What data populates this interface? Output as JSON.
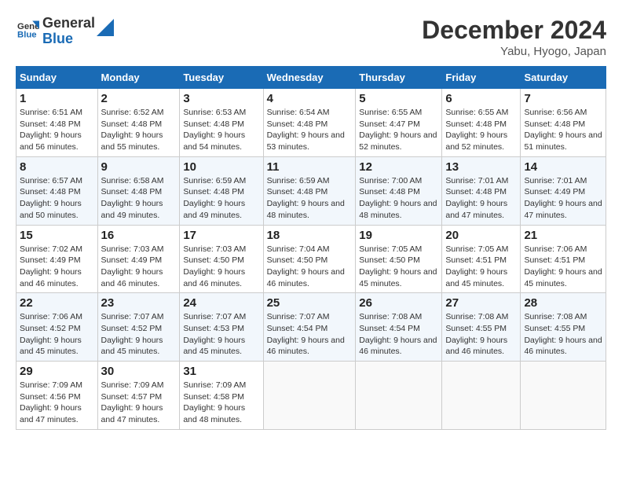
{
  "header": {
    "logo_line1": "General",
    "logo_line2": "Blue",
    "month": "December 2024",
    "location": "Yabu, Hyogo, Japan"
  },
  "weekdays": [
    "Sunday",
    "Monday",
    "Tuesday",
    "Wednesday",
    "Thursday",
    "Friday",
    "Saturday"
  ],
  "weeks": [
    [
      {
        "day": "1",
        "sunrise": "Sunrise: 6:51 AM",
        "sunset": "Sunset: 4:48 PM",
        "daylight": "Daylight: 9 hours and 56 minutes."
      },
      {
        "day": "2",
        "sunrise": "Sunrise: 6:52 AM",
        "sunset": "Sunset: 4:48 PM",
        "daylight": "Daylight: 9 hours and 55 minutes."
      },
      {
        "day": "3",
        "sunrise": "Sunrise: 6:53 AM",
        "sunset": "Sunset: 4:48 PM",
        "daylight": "Daylight: 9 hours and 54 minutes."
      },
      {
        "day": "4",
        "sunrise": "Sunrise: 6:54 AM",
        "sunset": "Sunset: 4:48 PM",
        "daylight": "Daylight: 9 hours and 53 minutes."
      },
      {
        "day": "5",
        "sunrise": "Sunrise: 6:55 AM",
        "sunset": "Sunset: 4:47 PM",
        "daylight": "Daylight: 9 hours and 52 minutes."
      },
      {
        "day": "6",
        "sunrise": "Sunrise: 6:55 AM",
        "sunset": "Sunset: 4:48 PM",
        "daylight": "Daylight: 9 hours and 52 minutes."
      },
      {
        "day": "7",
        "sunrise": "Sunrise: 6:56 AM",
        "sunset": "Sunset: 4:48 PM",
        "daylight": "Daylight: 9 hours and 51 minutes."
      }
    ],
    [
      {
        "day": "8",
        "sunrise": "Sunrise: 6:57 AM",
        "sunset": "Sunset: 4:48 PM",
        "daylight": "Daylight: 9 hours and 50 minutes."
      },
      {
        "day": "9",
        "sunrise": "Sunrise: 6:58 AM",
        "sunset": "Sunset: 4:48 PM",
        "daylight": "Daylight: 9 hours and 49 minutes."
      },
      {
        "day": "10",
        "sunrise": "Sunrise: 6:59 AM",
        "sunset": "Sunset: 4:48 PM",
        "daylight": "Daylight: 9 hours and 49 minutes."
      },
      {
        "day": "11",
        "sunrise": "Sunrise: 6:59 AM",
        "sunset": "Sunset: 4:48 PM",
        "daylight": "Daylight: 9 hours and 48 minutes."
      },
      {
        "day": "12",
        "sunrise": "Sunrise: 7:00 AM",
        "sunset": "Sunset: 4:48 PM",
        "daylight": "Daylight: 9 hours and 48 minutes."
      },
      {
        "day": "13",
        "sunrise": "Sunrise: 7:01 AM",
        "sunset": "Sunset: 4:48 PM",
        "daylight": "Daylight: 9 hours and 47 minutes."
      },
      {
        "day": "14",
        "sunrise": "Sunrise: 7:01 AM",
        "sunset": "Sunset: 4:49 PM",
        "daylight": "Daylight: 9 hours and 47 minutes."
      }
    ],
    [
      {
        "day": "15",
        "sunrise": "Sunrise: 7:02 AM",
        "sunset": "Sunset: 4:49 PM",
        "daylight": "Daylight: 9 hours and 46 minutes."
      },
      {
        "day": "16",
        "sunrise": "Sunrise: 7:03 AM",
        "sunset": "Sunset: 4:49 PM",
        "daylight": "Daylight: 9 hours and 46 minutes."
      },
      {
        "day": "17",
        "sunrise": "Sunrise: 7:03 AM",
        "sunset": "Sunset: 4:50 PM",
        "daylight": "Daylight: 9 hours and 46 minutes."
      },
      {
        "day": "18",
        "sunrise": "Sunrise: 7:04 AM",
        "sunset": "Sunset: 4:50 PM",
        "daylight": "Daylight: 9 hours and 46 minutes."
      },
      {
        "day": "19",
        "sunrise": "Sunrise: 7:05 AM",
        "sunset": "Sunset: 4:50 PM",
        "daylight": "Daylight: 9 hours and 45 minutes."
      },
      {
        "day": "20",
        "sunrise": "Sunrise: 7:05 AM",
        "sunset": "Sunset: 4:51 PM",
        "daylight": "Daylight: 9 hours and 45 minutes."
      },
      {
        "day": "21",
        "sunrise": "Sunrise: 7:06 AM",
        "sunset": "Sunset: 4:51 PM",
        "daylight": "Daylight: 9 hours and 45 minutes."
      }
    ],
    [
      {
        "day": "22",
        "sunrise": "Sunrise: 7:06 AM",
        "sunset": "Sunset: 4:52 PM",
        "daylight": "Daylight: 9 hours and 45 minutes."
      },
      {
        "day": "23",
        "sunrise": "Sunrise: 7:07 AM",
        "sunset": "Sunset: 4:52 PM",
        "daylight": "Daylight: 9 hours and 45 minutes."
      },
      {
        "day": "24",
        "sunrise": "Sunrise: 7:07 AM",
        "sunset": "Sunset: 4:53 PM",
        "daylight": "Daylight: 9 hours and 45 minutes."
      },
      {
        "day": "25",
        "sunrise": "Sunrise: 7:07 AM",
        "sunset": "Sunset: 4:54 PM",
        "daylight": "Daylight: 9 hours and 46 minutes."
      },
      {
        "day": "26",
        "sunrise": "Sunrise: 7:08 AM",
        "sunset": "Sunset: 4:54 PM",
        "daylight": "Daylight: 9 hours and 46 minutes."
      },
      {
        "day": "27",
        "sunrise": "Sunrise: 7:08 AM",
        "sunset": "Sunset: 4:55 PM",
        "daylight": "Daylight: 9 hours and 46 minutes."
      },
      {
        "day": "28",
        "sunrise": "Sunrise: 7:08 AM",
        "sunset": "Sunset: 4:55 PM",
        "daylight": "Daylight: 9 hours and 46 minutes."
      }
    ],
    [
      {
        "day": "29",
        "sunrise": "Sunrise: 7:09 AM",
        "sunset": "Sunset: 4:56 PM",
        "daylight": "Daylight: 9 hours and 47 minutes."
      },
      {
        "day": "30",
        "sunrise": "Sunrise: 7:09 AM",
        "sunset": "Sunset: 4:57 PM",
        "daylight": "Daylight: 9 hours and 47 minutes."
      },
      {
        "day": "31",
        "sunrise": "Sunrise: 7:09 AM",
        "sunset": "Sunset: 4:58 PM",
        "daylight": "Daylight: 9 hours and 48 minutes."
      },
      null,
      null,
      null,
      null
    ]
  ]
}
